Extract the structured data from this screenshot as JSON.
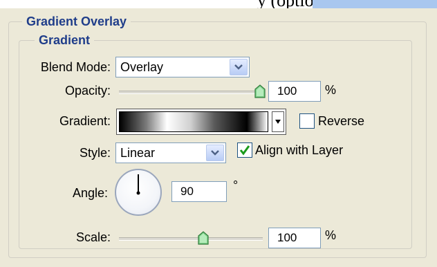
{
  "panel": {
    "title": "Gradient Overlay",
    "section_title": "Gradient"
  },
  "fields": {
    "blend_mode": {
      "label": "Blend Mode:",
      "value": "Overlay"
    },
    "opacity": {
      "label": "Opacity:",
      "value": "100",
      "unit": "%",
      "level_percent": 100
    },
    "gradient": {
      "label": "Gradient:"
    },
    "reverse": {
      "label": "Reverse",
      "checked": false
    },
    "style": {
      "label": "Style:",
      "value": "Linear"
    },
    "align_with_layer": {
      "label": "Align with Layer",
      "checked": true
    },
    "angle": {
      "label": "Angle:",
      "value": "90",
      "unit": "°",
      "degrees": 90
    },
    "scale": {
      "label": "Scale:",
      "value": "100",
      "unit": "%",
      "level_percent": 58
    }
  },
  "colors": {
    "legend_text": "#1f3d8a",
    "panel_bg": "#ece9d8",
    "check_green": "#1a9a1a"
  },
  "icons": {
    "dropdown": "chevron-down-icon",
    "slider_thumb": "slider-thumb-icon",
    "checkmark": "checkmark-icon"
  }
}
